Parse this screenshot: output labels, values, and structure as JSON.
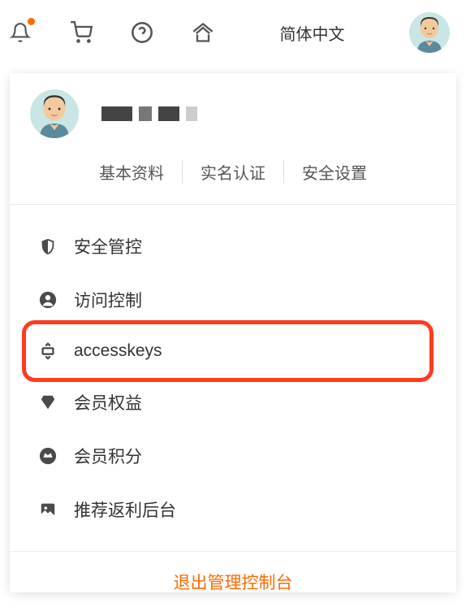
{
  "topbar": {
    "language": "简体中文"
  },
  "user": {
    "tabs": {
      "profile": "基本资料",
      "verify": "实名认证",
      "security": "安全设置"
    }
  },
  "menu": {
    "security_control": "安全管控",
    "access_control": "访问控制",
    "accesskeys": "accesskeys",
    "member_benefits": "会员权益",
    "member_points": "会员积分",
    "referral": "推荐返利后台"
  },
  "logout": "退出管理控制台"
}
